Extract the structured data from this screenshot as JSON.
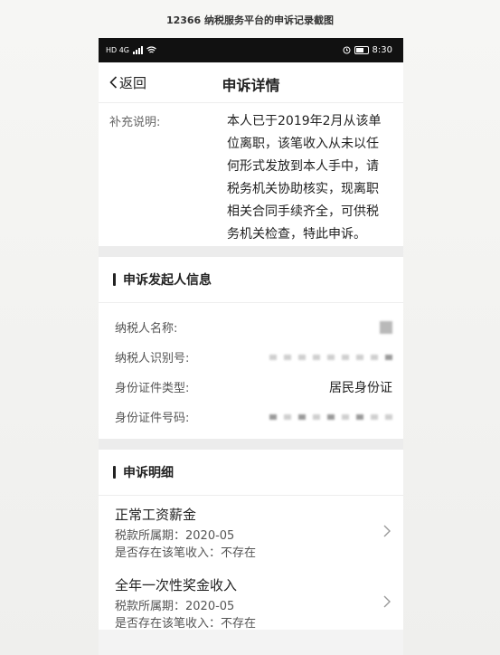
{
  "caption": "12366 纳税服务平台的申诉记录截图",
  "status_bar": {
    "time": "8:30",
    "network": "HD 4G"
  },
  "nav": {
    "back_label": "返回",
    "title": "申诉详情"
  },
  "supplement": {
    "label": "补充说明:",
    "text": "本人已于2019年2月从该单位离职，该笔收入从未以任何形式发放到本人手中，请税务机关协助核实，现离职相关合同手续齐全，可供税务机关检查，特此申诉。"
  },
  "initiator": {
    "title": "申诉发起人信息",
    "fields": [
      {
        "key": "纳税人名称:",
        "value": ""
      },
      {
        "key": "纳税人识别号:",
        "value": ""
      },
      {
        "key": "身份证件类型:",
        "value": "居民身份证"
      },
      {
        "key": "身份证件号码:",
        "value": ""
      }
    ]
  },
  "details": {
    "title": "申诉明细",
    "items": [
      {
        "title": "正常工资薪金",
        "period": "税款所属期：2020-05",
        "exists": "是否存在该笔收入：不存在"
      },
      {
        "title": "全年一次性奖金收入",
        "period": "税款所属期：2020-05",
        "exists": "是否存在该笔收入：不存在"
      }
    ]
  },
  "icons": {
    "back": "chevron-left-icon",
    "row": "chevron-right-icon"
  }
}
